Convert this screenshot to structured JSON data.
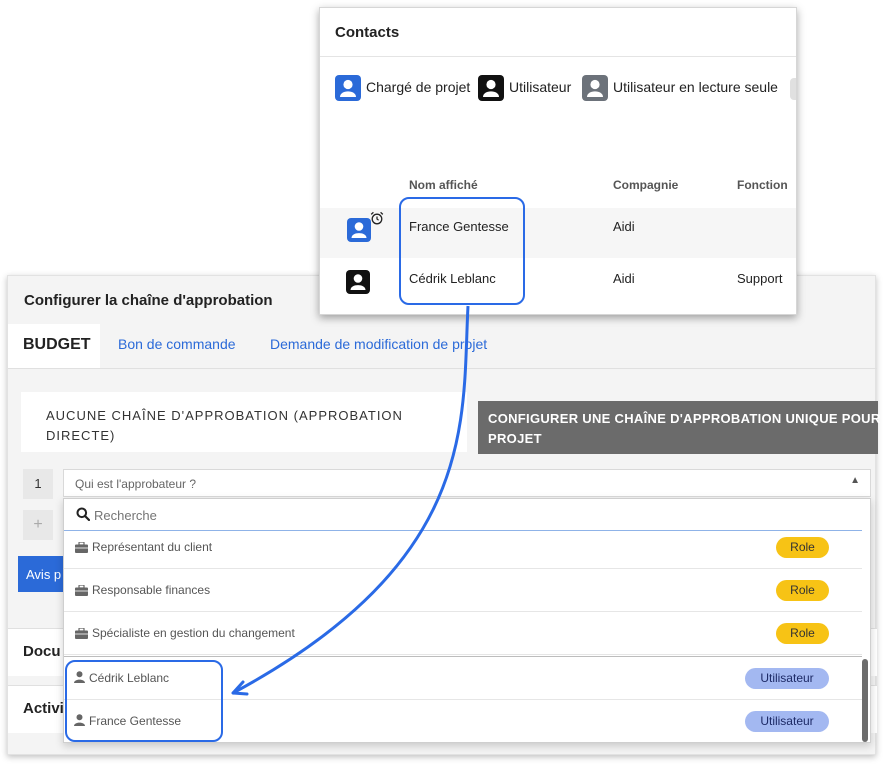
{
  "colors": {
    "accent": "#2b6ad8",
    "highlight": "#2a6ae6",
    "role_badge": "#f7c315",
    "user_badge": "#a3b8f1",
    "dark_button": "#6b6b6b"
  },
  "approval": {
    "title": "Configurer la chaîne d'approbation",
    "tabs": [
      {
        "label": "BUDGET",
        "active": true
      },
      {
        "label": "Bon de commande",
        "active": false
      },
      {
        "label": "Demande de modification de projet",
        "active": false
      }
    ],
    "no_chain_line1": "AUCUNE CHAÎNE D'APPROBATION (APPROBATION",
    "no_chain_line2": "DIRECTE)",
    "unique_chain_line1": "CONFIGURER UNE CHAÎNE D'APPROBATION UNIQUE POUR",
    "unique_chain_line2": "PROJET",
    "step_number": "1",
    "approver_placeholder": "Qui est l'approbateur ?",
    "add_step": "+",
    "notify_button": "Avis p",
    "sections": [
      "Docu",
      "Activi"
    ]
  },
  "dropdown": {
    "search_placeholder": "Recherche",
    "options": [
      {
        "label": "Représentant du client",
        "badge": "Role",
        "icon": "briefcase-icon"
      },
      {
        "label": "Responsable finances",
        "badge": "Role",
        "icon": "briefcase-icon"
      },
      {
        "label": "Spécialiste en gestion du changement",
        "badge": "Role",
        "icon": "briefcase-icon"
      },
      {
        "label": "Cédrik Leblanc",
        "badge": "Utilisateur",
        "icon": "person-icon"
      },
      {
        "label": "France Gentesse",
        "badge": "Utilisateur",
        "icon": "person-icon"
      }
    ]
  },
  "contacts": {
    "title": "Contacts",
    "legend": [
      {
        "label": "Chargé de projet",
        "color": "#2b6ad8"
      },
      {
        "label": "Utilisateur",
        "color": "#111111"
      },
      {
        "label": "Utilisateur en lecture seule",
        "color": "#6c727a"
      }
    ],
    "columns": [
      "Nom affiché",
      "Compagnie",
      "Fonction"
    ],
    "rows": [
      {
        "name": "France Gentesse",
        "company": "Aidi",
        "function": ""
      },
      {
        "name": "Cédrik Leblanc",
        "company": "Aidi",
        "function": "Support"
      }
    ]
  }
}
